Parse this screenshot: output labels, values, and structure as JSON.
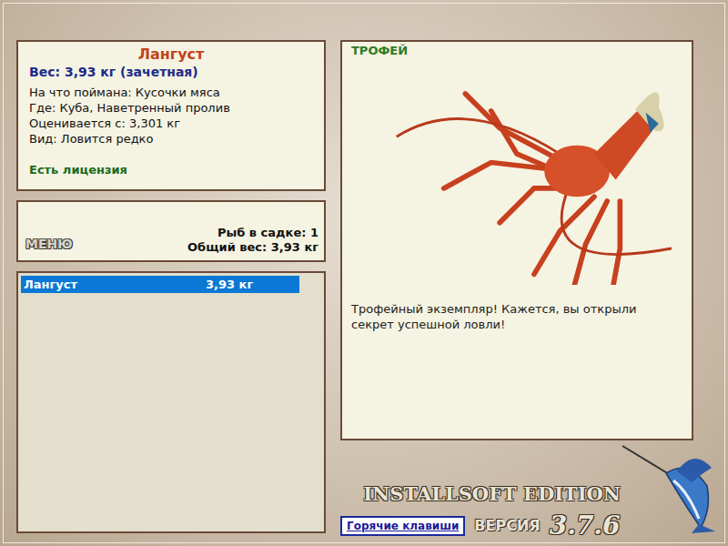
{
  "catch": {
    "name": "Лангуст",
    "weight": "Вес: 3,93 кг (зачетная)",
    "details": [
      "На что поймана: Кусочки мяса",
      "Где: Куба, Наветренный пролив",
      "Оценивается с: 3,301 кг",
      "Вид: Ловится редко"
    ],
    "license": "Есть лицензия"
  },
  "menu": {
    "label": "МЕНЮ",
    "count": "Рыб в садке: 1",
    "total": "Общий вес: 3,93 кг"
  },
  "keepnet": [
    {
      "name": "Лангуст",
      "weight": "3,93 кг",
      "selected": true
    }
  ],
  "trophy": {
    "badge": "ТРОФЕЙ",
    "message": "Трофейный экземпляр! Кажется, вы открыли секрет успешной ловли!"
  },
  "footer": {
    "edition": "INSTALLSOFT EDITION",
    "version_label": "ВЕРСИЯ",
    "version": "3.7.6",
    "hotkeys": "Горячие клавиши"
  }
}
